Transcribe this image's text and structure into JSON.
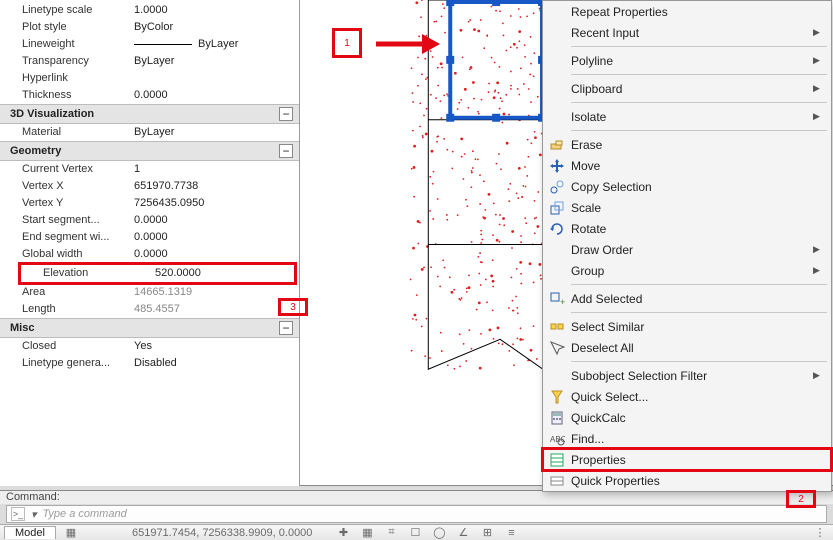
{
  "properties": {
    "general": {
      "linetype_scale": {
        "k": "Linetype scale",
        "v": "1.0000"
      },
      "plot_style": {
        "k": "Plot style",
        "v": "ByColor"
      },
      "lineweight": {
        "k": "Lineweight",
        "v": "ByLayer"
      },
      "transparency": {
        "k": "Transparency",
        "v": "ByLayer"
      },
      "hyperlink": {
        "k": "Hyperlink",
        "v": ""
      },
      "thickness": {
        "k": "Thickness",
        "v": "0.0000"
      }
    },
    "section_3d": "3D Visualization",
    "threeD": {
      "material": {
        "k": "Material",
        "v": "ByLayer"
      }
    },
    "section_geom": "Geometry",
    "geometry": {
      "current_vertex": {
        "k": "Current Vertex",
        "v": "1"
      },
      "vertex_x": {
        "k": "Vertex X",
        "v": "651970.7738"
      },
      "vertex_y": {
        "k": "Vertex Y",
        "v": "7256435.0950"
      },
      "start_seg_w": {
        "k": "Start segment...",
        "v": "0.0000"
      },
      "end_seg_w": {
        "k": "End segment wi...",
        "v": "0.0000"
      },
      "global_width": {
        "k": "Global width",
        "v": "0.0000"
      },
      "elevation": {
        "k": "Elevation",
        "v": "520.0000"
      },
      "area": {
        "k": "Area",
        "v": "14665.1319"
      },
      "length": {
        "k": "Length",
        "v": "485.4557"
      }
    },
    "section_misc": "Misc",
    "misc": {
      "closed": {
        "k": "Closed",
        "v": "Yes"
      },
      "linetype_gen": {
        "k": "Linetype genera...",
        "v": "Disabled"
      }
    }
  },
  "callouts": {
    "one": "1",
    "two": "2",
    "three": "3"
  },
  "context_menu": {
    "repeat": "Repeat Properties",
    "recent_input": "Recent Input",
    "polyline": "Polyline",
    "clipboard": "Clipboard",
    "isolate": "Isolate",
    "erase": "Erase",
    "move": "Move",
    "copy_sel": "Copy Selection",
    "scale": "Scale",
    "rotate": "Rotate",
    "draw_order": "Draw Order",
    "group": "Group",
    "add_selected": "Add Selected",
    "select_similar": "Select Similar",
    "deselect_all": "Deselect All",
    "subobj_filter": "Subobject Selection Filter",
    "quick_select": "Quick Select...",
    "quickcalc": "QuickCalc",
    "find": "Find...",
    "properties": "Properties",
    "quick_properties": "Quick Properties"
  },
  "command": {
    "label": "Command:",
    "placeholder": "Type a command"
  },
  "status": {
    "model_tab": "Model",
    "coords": "651971.7454, 7256338.9909, 0.0000"
  }
}
